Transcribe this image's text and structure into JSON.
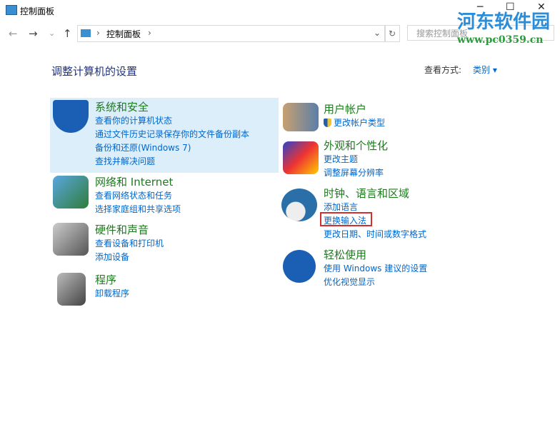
{
  "window": {
    "title": "控制面板",
    "min": "─",
    "max": "☐",
    "close": "✕"
  },
  "nav": {
    "back": "←",
    "forward": "→",
    "recent": "⌄",
    "up": "↑"
  },
  "address": {
    "sep": "›",
    "crumb": "控制面板",
    "sep2": "›",
    "dropdown": "⌄",
    "refresh": "↻"
  },
  "search": {
    "placeholder": "搜索控制面板"
  },
  "heading": "调整计算机的设置",
  "view": {
    "label": "查看方式:",
    "value": "类别 ▾"
  },
  "left": [
    {
      "title": "系统和安全",
      "links": [
        "查看你的计算机状态",
        "通过文件历史记录保存你的文件备份副本",
        "备份和还原(Windows 7)",
        "查找并解决问题"
      ]
    },
    {
      "title": "网络和 Internet",
      "links": [
        "查看网络状态和任务",
        "选择家庭组和共享选项"
      ]
    },
    {
      "title": "硬件和声音",
      "links": [
        "查看设备和打印机",
        "添加设备"
      ]
    },
    {
      "title": "程序",
      "links": [
        "卸载程序"
      ]
    }
  ],
  "right": [
    {
      "title": "用户帐户",
      "links": [
        "更改帐户类型"
      ]
    },
    {
      "title": "外观和个性化",
      "links": [
        "更改主题",
        "调整屏幕分辨率"
      ]
    },
    {
      "title": "时钟、语言和区域",
      "links": [
        "添加语言",
        "更换输入法",
        "更改日期、时间或数字格式"
      ]
    },
    {
      "title": "轻松使用",
      "links": [
        "使用 Windows 建议的设置",
        "优化视觉显示"
      ]
    }
  ],
  "watermark": {
    "name": "河东软件园",
    "url": "www.pc0359.cn"
  }
}
